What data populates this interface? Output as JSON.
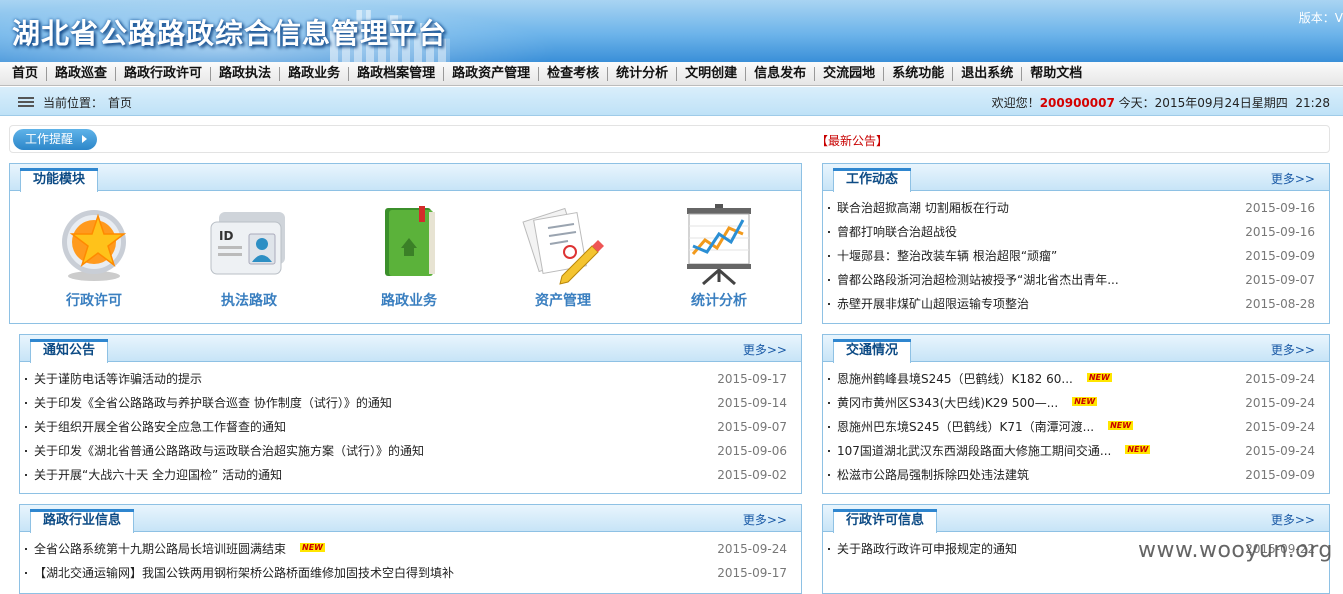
{
  "header": {
    "title": "湖北省公路路政综合信息管理平台",
    "version": "版本：V"
  },
  "nav": [
    "首页",
    "路政巡查",
    "路政行政许可",
    "路政执法",
    "路政业务",
    "路政档案管理",
    "路政资产管理",
    "检查考核",
    "统计分析",
    "文明创建",
    "信息发布",
    "交流园地",
    "系统功能",
    "退出系统",
    "帮助文档"
  ],
  "location": {
    "label": "当前位置：",
    "value": "首页"
  },
  "welcome": {
    "prefix": "欢迎您！",
    "user": "200900007",
    "date_text": "今天：2015年09月24日星期四",
    "time": "21:28"
  },
  "reminder": {
    "button": "工作提醒",
    "notice": "【最新公告】"
  },
  "modules": {
    "title": "功能模块",
    "items": [
      {
        "label": "行政许可",
        "icon": "star-badge-icon"
      },
      {
        "label": "执法路政",
        "icon": "id-card-icon"
      },
      {
        "label": "路政业务",
        "icon": "green-book-icon"
      },
      {
        "label": "资产管理",
        "icon": "document-pen-icon"
      },
      {
        "label": "统计分析",
        "icon": "chart-board-icon"
      }
    ]
  },
  "more_label": "更多>>",
  "new_badge": "NEW",
  "panels": {
    "work": {
      "title": "工作动态",
      "items": [
        {
          "text": "联合治超掀高潮 切割厢板在行动",
          "date": "2015-09-16"
        },
        {
          "text": "曾都打响联合治超战役",
          "date": "2015-09-16"
        },
        {
          "text": "十堰郧县：整治改装车辆 根治超限“顽瘤”",
          "date": "2015-09-09"
        },
        {
          "text": "曾都公路段浙河治超检测站被授予“湖北省杰出青年...",
          "date": "2015-09-07"
        },
        {
          "text": "赤壁开展非煤矿山超限运输专项整治",
          "date": "2015-08-28"
        }
      ]
    },
    "notice": {
      "title": "通知公告",
      "items": [
        {
          "text": "关于谨防电话等诈骗活动的提示",
          "date": "2015-09-17"
        },
        {
          "text": "关于印发《全省公路路政与养护联合巡查 协作制度（试行）》的通知",
          "date": "2015-09-14"
        },
        {
          "text": "关于组织开展全省公路安全应急工作督查的通知",
          "date": "2015-09-07"
        },
        {
          "text": "关于印发《湖北省普通公路路政与运政联合治超实施方案（试行）》的通知",
          "date": "2015-09-06"
        },
        {
          "text": "关于开展“大战六十天 全力迎国检” 活动的通知",
          "date": "2015-09-02"
        }
      ]
    },
    "traffic": {
      "title": "交通情况",
      "items": [
        {
          "text": "恩施州鹤峰县境S245（巴鹤线）K182 60...",
          "date": "2015-09-24",
          "new": true
        },
        {
          "text": "黄冈市黄州区S343(大巴线)K29 500—...",
          "date": "2015-09-24",
          "new": true
        },
        {
          "text": "恩施州巴东境S245（巴鹤线）K71（南潭河渡...",
          "date": "2015-09-24",
          "new": true
        },
        {
          "text": "107国道湖北武汉东西湖段路面大修施工期间交通...",
          "date": "2015-09-24",
          "new": true
        },
        {
          "text": "松滋市公路局强制拆除四处违法建筑",
          "date": "2015-09-09",
          "new": false
        }
      ]
    },
    "industry": {
      "title": "路政行业信息",
      "items": [
        {
          "text": "全省公路系统第十九期公路局长培训班圆满结束",
          "date": "2015-09-24",
          "new": true
        },
        {
          "text": "【湖北交通运输网】我国公铁两用钢桁架桥公路桥面维修加固技术空白得到填补",
          "date": "2015-09-17",
          "new": false
        }
      ]
    },
    "permit": {
      "title": "行政许可信息",
      "items": [
        {
          "text": "关于路政行政许可申报规定的通知",
          "date": "2015-09-22"
        }
      ]
    }
  },
  "watermark": "www.wooyun.org"
}
